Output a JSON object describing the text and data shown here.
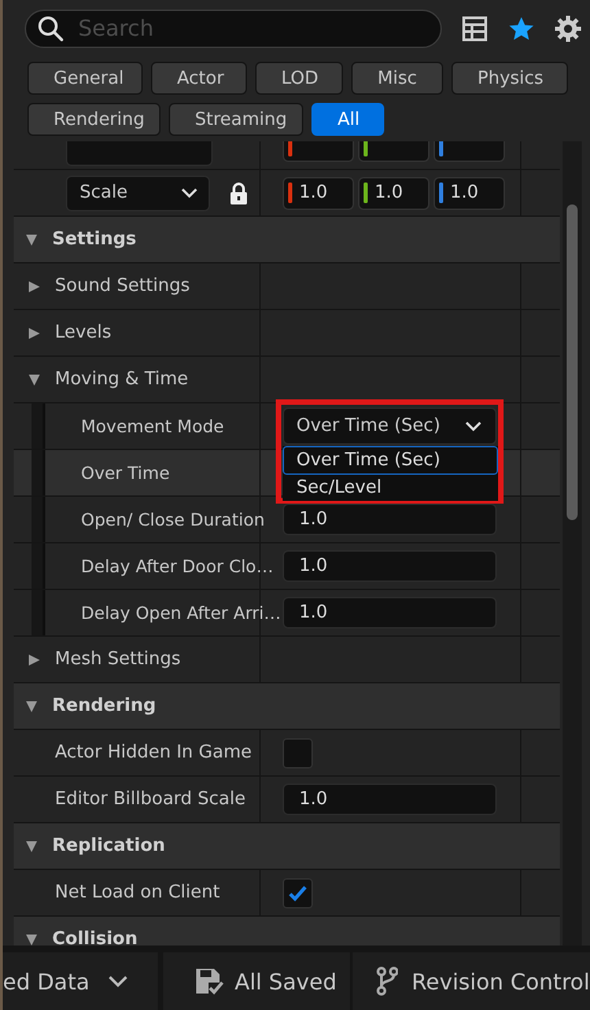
{
  "search": {
    "placeholder": "Search"
  },
  "filters": [
    {
      "label": "General",
      "selected": false
    },
    {
      "label": "Actor",
      "selected": false
    },
    {
      "label": "LOD",
      "selected": false
    },
    {
      "label": "Misc",
      "selected": false
    },
    {
      "label": "Physics",
      "selected": false
    },
    {
      "label": "Rendering",
      "selected": false
    },
    {
      "label": "Streaming",
      "selected": false
    },
    {
      "label": "All",
      "selected": true
    }
  ],
  "transform": {
    "mode": "Scale",
    "locked": true,
    "values": [
      {
        "text": "1.0",
        "color": "#d9300f"
      },
      {
        "text": "1.0",
        "color": "#6cb51c"
      },
      {
        "text": "1.0",
        "color": "#2f7fe0"
      }
    ]
  },
  "sections": [
    {
      "title": "Settings",
      "expanded": true,
      "rows": [
        {
          "kind": "group",
          "label": "Sound Settings",
          "expanded": false
        },
        {
          "kind": "group",
          "label": "Levels",
          "expanded": false
        },
        {
          "kind": "group",
          "label": "Moving & Time",
          "expanded": true,
          "children": [
            {
              "kind": "dropdown",
              "label": "Movement Mode",
              "value": "Over Time (Sec)",
              "open": true,
              "marked": true,
              "options": [
                {
                  "label": "Over Time (Sec)",
                  "selected": true
                },
                {
                  "label": "Sec/Level",
                  "selected": false
                }
              ]
            },
            {
              "kind": "hidden",
              "label": "Over Time",
              "hovered": true
            },
            {
              "kind": "number",
              "label": "Open/ Close Duration",
              "value": "1.0"
            },
            {
              "kind": "number",
              "label": "Delay After Door Clo…",
              "value": "1.0"
            },
            {
              "kind": "number",
              "label": "Delay Open After Arri…",
              "value": "1.0"
            }
          ]
        },
        {
          "kind": "group",
          "label": "Mesh Settings",
          "expanded": false
        }
      ]
    },
    {
      "title": "Rendering",
      "expanded": true,
      "rows": [
        {
          "kind": "checkbox",
          "label": "Actor Hidden In Game",
          "checked": false
        },
        {
          "kind": "number",
          "label": "Editor Billboard Scale",
          "value": "1.0"
        }
      ]
    },
    {
      "title": "Replication",
      "expanded": true,
      "rows": [
        {
          "kind": "checkbox",
          "label": "Net Load on Client",
          "checked": true
        }
      ]
    },
    {
      "title": "Collision",
      "expanded": true
    }
  ],
  "status_bar": [
    {
      "kind": "menu",
      "label": "ed Data"
    },
    {
      "kind": "saved",
      "label": "All Saved"
    },
    {
      "kind": "branch",
      "label": "Revision Control"
    }
  ]
}
